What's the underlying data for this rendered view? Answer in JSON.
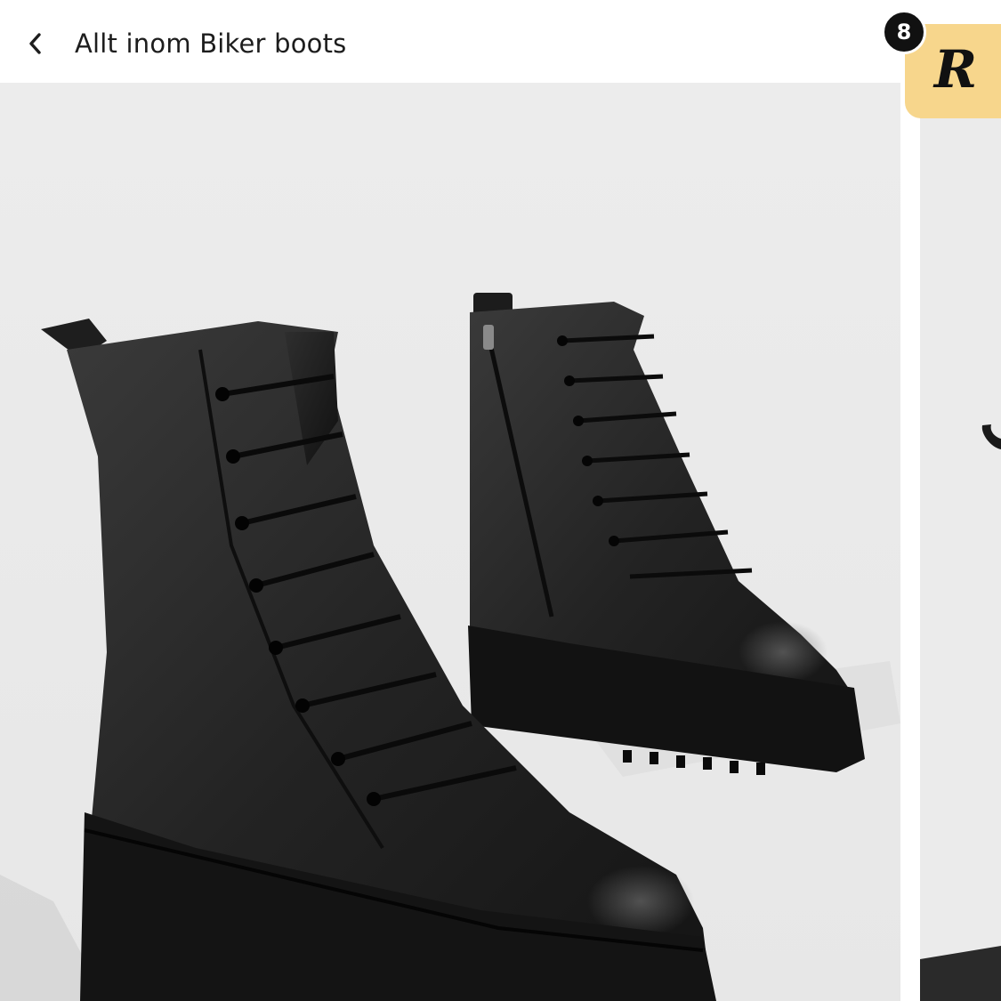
{
  "header": {
    "back_label": "Allt inom Biker boots",
    "back_icon": "chevron-left-icon"
  },
  "rewards": {
    "count": "8",
    "logo_letter": "R",
    "badge_color": "#f7d68c",
    "count_color": "#111111"
  },
  "product_gallery": {
    "image_subject": "black leather lace-up biker boots",
    "background_color": "#ebebeb"
  }
}
